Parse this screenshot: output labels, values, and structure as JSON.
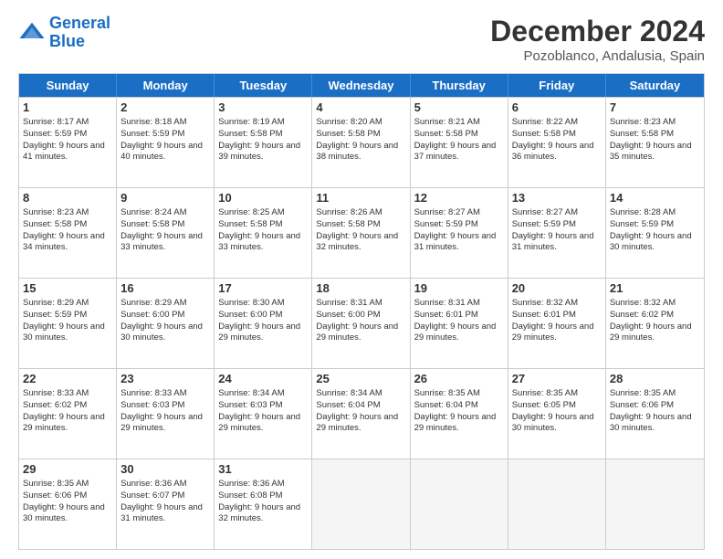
{
  "logo": {
    "line1": "General",
    "line2": "Blue"
  },
  "title": "December 2024",
  "subtitle": "Pozoblanco, Andalusia, Spain",
  "header_days": [
    "Sunday",
    "Monday",
    "Tuesday",
    "Wednesday",
    "Thursday",
    "Friday",
    "Saturday"
  ],
  "rows": [
    [
      {
        "day": "1",
        "sunrise": "Sunrise: 8:17 AM",
        "sunset": "Sunset: 5:59 PM",
        "daylight": "Daylight: 9 hours and 41 minutes."
      },
      {
        "day": "2",
        "sunrise": "Sunrise: 8:18 AM",
        "sunset": "Sunset: 5:59 PM",
        "daylight": "Daylight: 9 hours and 40 minutes."
      },
      {
        "day": "3",
        "sunrise": "Sunrise: 8:19 AM",
        "sunset": "Sunset: 5:58 PM",
        "daylight": "Daylight: 9 hours and 39 minutes."
      },
      {
        "day": "4",
        "sunrise": "Sunrise: 8:20 AM",
        "sunset": "Sunset: 5:58 PM",
        "daylight": "Daylight: 9 hours and 38 minutes."
      },
      {
        "day": "5",
        "sunrise": "Sunrise: 8:21 AM",
        "sunset": "Sunset: 5:58 PM",
        "daylight": "Daylight: 9 hours and 37 minutes."
      },
      {
        "day": "6",
        "sunrise": "Sunrise: 8:22 AM",
        "sunset": "Sunset: 5:58 PM",
        "daylight": "Daylight: 9 hours and 36 minutes."
      },
      {
        "day": "7",
        "sunrise": "Sunrise: 8:23 AM",
        "sunset": "Sunset: 5:58 PM",
        "daylight": "Daylight: 9 hours and 35 minutes."
      }
    ],
    [
      {
        "day": "8",
        "sunrise": "Sunrise: 8:23 AM",
        "sunset": "Sunset: 5:58 PM",
        "daylight": "Daylight: 9 hours and 34 minutes."
      },
      {
        "day": "9",
        "sunrise": "Sunrise: 8:24 AM",
        "sunset": "Sunset: 5:58 PM",
        "daylight": "Daylight: 9 hours and 33 minutes."
      },
      {
        "day": "10",
        "sunrise": "Sunrise: 8:25 AM",
        "sunset": "Sunset: 5:58 PM",
        "daylight": "Daylight: 9 hours and 33 minutes."
      },
      {
        "day": "11",
        "sunrise": "Sunrise: 8:26 AM",
        "sunset": "Sunset: 5:58 PM",
        "daylight": "Daylight: 9 hours and 32 minutes."
      },
      {
        "day": "12",
        "sunrise": "Sunrise: 8:27 AM",
        "sunset": "Sunset: 5:59 PM",
        "daylight": "Daylight: 9 hours and 31 minutes."
      },
      {
        "day": "13",
        "sunrise": "Sunrise: 8:27 AM",
        "sunset": "Sunset: 5:59 PM",
        "daylight": "Daylight: 9 hours and 31 minutes."
      },
      {
        "day": "14",
        "sunrise": "Sunrise: 8:28 AM",
        "sunset": "Sunset: 5:59 PM",
        "daylight": "Daylight: 9 hours and 30 minutes."
      }
    ],
    [
      {
        "day": "15",
        "sunrise": "Sunrise: 8:29 AM",
        "sunset": "Sunset: 5:59 PM",
        "daylight": "Daylight: 9 hours and 30 minutes."
      },
      {
        "day": "16",
        "sunrise": "Sunrise: 8:29 AM",
        "sunset": "Sunset: 6:00 PM",
        "daylight": "Daylight: 9 hours and 30 minutes."
      },
      {
        "day": "17",
        "sunrise": "Sunrise: 8:30 AM",
        "sunset": "Sunset: 6:00 PM",
        "daylight": "Daylight: 9 hours and 29 minutes."
      },
      {
        "day": "18",
        "sunrise": "Sunrise: 8:31 AM",
        "sunset": "Sunset: 6:00 PM",
        "daylight": "Daylight: 9 hours and 29 minutes."
      },
      {
        "day": "19",
        "sunrise": "Sunrise: 8:31 AM",
        "sunset": "Sunset: 6:01 PM",
        "daylight": "Daylight: 9 hours and 29 minutes."
      },
      {
        "day": "20",
        "sunrise": "Sunrise: 8:32 AM",
        "sunset": "Sunset: 6:01 PM",
        "daylight": "Daylight: 9 hours and 29 minutes."
      },
      {
        "day": "21",
        "sunrise": "Sunrise: 8:32 AM",
        "sunset": "Sunset: 6:02 PM",
        "daylight": "Daylight: 9 hours and 29 minutes."
      }
    ],
    [
      {
        "day": "22",
        "sunrise": "Sunrise: 8:33 AM",
        "sunset": "Sunset: 6:02 PM",
        "daylight": "Daylight: 9 hours and 29 minutes."
      },
      {
        "day": "23",
        "sunrise": "Sunrise: 8:33 AM",
        "sunset": "Sunset: 6:03 PM",
        "daylight": "Daylight: 9 hours and 29 minutes."
      },
      {
        "day": "24",
        "sunrise": "Sunrise: 8:34 AM",
        "sunset": "Sunset: 6:03 PM",
        "daylight": "Daylight: 9 hours and 29 minutes."
      },
      {
        "day": "25",
        "sunrise": "Sunrise: 8:34 AM",
        "sunset": "Sunset: 6:04 PM",
        "daylight": "Daylight: 9 hours and 29 minutes."
      },
      {
        "day": "26",
        "sunrise": "Sunrise: 8:35 AM",
        "sunset": "Sunset: 6:04 PM",
        "daylight": "Daylight: 9 hours and 29 minutes."
      },
      {
        "day": "27",
        "sunrise": "Sunrise: 8:35 AM",
        "sunset": "Sunset: 6:05 PM",
        "daylight": "Daylight: 9 hours and 30 minutes."
      },
      {
        "day": "28",
        "sunrise": "Sunrise: 8:35 AM",
        "sunset": "Sunset: 6:06 PM",
        "daylight": "Daylight: 9 hours and 30 minutes."
      }
    ],
    [
      {
        "day": "29",
        "sunrise": "Sunrise: 8:35 AM",
        "sunset": "Sunset: 6:06 PM",
        "daylight": "Daylight: 9 hours and 30 minutes."
      },
      {
        "day": "30",
        "sunrise": "Sunrise: 8:36 AM",
        "sunset": "Sunset: 6:07 PM",
        "daylight": "Daylight: 9 hours and 31 minutes."
      },
      {
        "day": "31",
        "sunrise": "Sunrise: 8:36 AM",
        "sunset": "Sunset: 6:08 PM",
        "daylight": "Daylight: 9 hours and 32 minutes."
      },
      {
        "day": "",
        "sunrise": "",
        "sunset": "",
        "daylight": ""
      },
      {
        "day": "",
        "sunrise": "",
        "sunset": "",
        "daylight": ""
      },
      {
        "day": "",
        "sunrise": "",
        "sunset": "",
        "daylight": ""
      },
      {
        "day": "",
        "sunrise": "",
        "sunset": "",
        "daylight": ""
      }
    ]
  ]
}
